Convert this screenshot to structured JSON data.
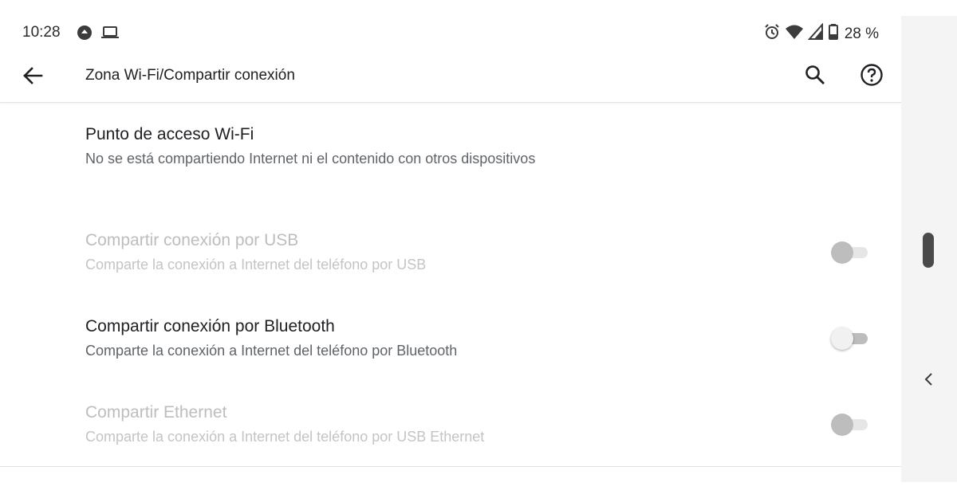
{
  "status_bar": {
    "time": "10:28",
    "left_icons": [
      "notification-dot-icon",
      "laptop-icon"
    ],
    "right_icons": [
      "alarm-icon",
      "wifi-icon",
      "cell-signal-icon",
      "battery-icon"
    ],
    "battery_percent": "28 %"
  },
  "app_bar": {
    "title": "Zona Wi-Fi/Compartir conexión",
    "back_icon": "arrow-back-icon",
    "search_icon": "search-icon",
    "help_icon": "help-icon"
  },
  "preferences": [
    {
      "title": "Punto de acceso Wi-Fi",
      "summary": "No se está compartiendo Internet ni el contenido con otros dispositivos",
      "enabled": true,
      "has_switch": false
    },
    {
      "title": "Compartir conexión por USB",
      "summary": "Comparte la conexión a Internet del teléfono por USB",
      "enabled": false,
      "has_switch": true,
      "checked": false
    },
    {
      "title": "Compartir conexión por Bluetooth",
      "summary": "Comparte la conexión a Internet del teléfono por Bluetooth",
      "enabled": true,
      "has_switch": true,
      "checked": false
    },
    {
      "title": "Compartir Ethernet",
      "summary": "Comparte la conexión a Internet del teléfono por USB Ethernet",
      "enabled": false,
      "has_switch": true,
      "checked": false
    }
  ],
  "side_nav": {
    "handle_icon": "scroll-handle-icon",
    "chevron_icon": "chevron-left-icon"
  },
  "colors": {
    "text_primary": "#202124",
    "text_secondary": "#5f6368",
    "text_disabled": "#bdbdbd",
    "divider": "#e3e3e3",
    "side_strip": "#f4f4f4"
  }
}
